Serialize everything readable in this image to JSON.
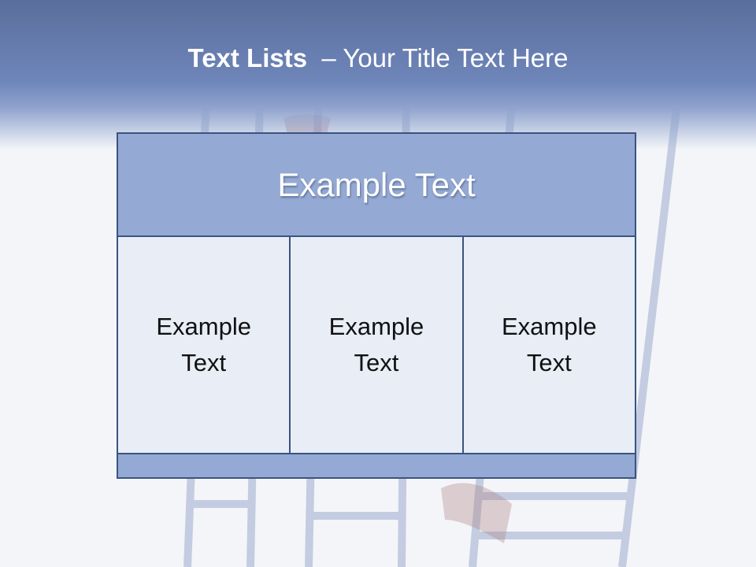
{
  "slide": {
    "title_bold": "Text Lists",
    "title_rest": "– Your Title Text Here"
  },
  "table": {
    "header": "Example Text",
    "cells": [
      "Example Text",
      "Example Text",
      "Example Text"
    ]
  },
  "colors": {
    "title_band": "#6f86ba",
    "header_fill": "#94a9d3",
    "cell_fill": "#e8edf6",
    "border": "#3a5480"
  }
}
